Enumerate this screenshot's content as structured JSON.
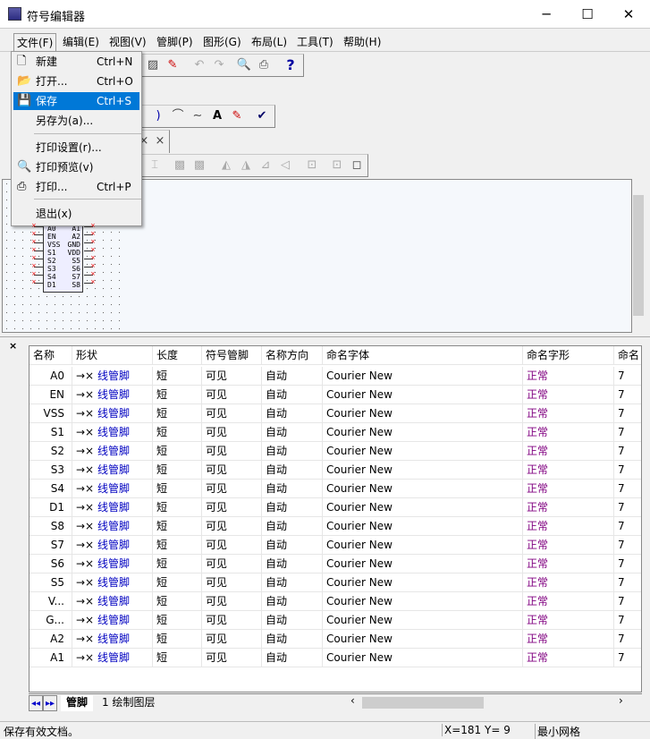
{
  "window": {
    "title": "符号编辑器",
    "minimize": "─",
    "maximize": "☐",
    "close": "✕"
  },
  "menubar": [
    "文件(F)",
    "编辑(E)",
    "视图(V)",
    "管脚(P)",
    "图形(G)",
    "布局(L)",
    "工具(T)",
    "帮助(H)"
  ],
  "file_menu": [
    {
      "label": "新建",
      "shortcut": "Ctrl+N",
      "icon": "new-file-icon"
    },
    {
      "label": "打开...",
      "shortcut": "Ctrl+O",
      "icon": "open-folder-icon"
    },
    {
      "label": "保存",
      "shortcut": "Ctrl+S",
      "icon": "save-icon",
      "selected": true
    },
    {
      "label": "另存为(a)...",
      "shortcut": ""
    },
    {
      "label": "打印设置(r)...",
      "shortcut": ""
    },
    {
      "label": "打印预览(v)",
      "shortcut": "",
      "icon": "print-preview-icon"
    },
    {
      "label": "打印...",
      "shortcut": "Ctrl+P",
      "icon": "printer-icon"
    },
    {
      "label": "退出(x)",
      "shortcut": ""
    }
  ],
  "toolbar": {
    "help": "?",
    "text_tool": "A",
    "close_a": "×",
    "close_b": "×"
  },
  "symbol": {
    "left_pins": [
      "A0",
      "EN",
      "VSS",
      "S1",
      "S2",
      "S3",
      "S4",
      "D1"
    ],
    "right_pins": [
      "A1",
      "A2",
      "GND",
      "VDD",
      "S5",
      "S6",
      "S7",
      "S8"
    ]
  },
  "panel_close": "×",
  "table": {
    "columns": [
      "名称",
      "形状",
      "长度",
      "符号管脚",
      "名称方向",
      "命名字体",
      "命名字形",
      "命名"
    ],
    "rows": [
      [
        "A0",
        "→× 线管脚",
        "短",
        "可见",
        "自动",
        "Courier New",
        "正常",
        "7"
      ],
      [
        "EN",
        "→× 线管脚",
        "短",
        "可见",
        "自动",
        "Courier New",
        "正常",
        "7"
      ],
      [
        "VSS",
        "→× 线管脚",
        "短",
        "可见",
        "自动",
        "Courier New",
        "正常",
        "7"
      ],
      [
        "S1",
        "→× 线管脚",
        "短",
        "可见",
        "自动",
        "Courier New",
        "正常",
        "7"
      ],
      [
        "S2",
        "→× 线管脚",
        "短",
        "可见",
        "自动",
        "Courier New",
        "正常",
        "7"
      ],
      [
        "S3",
        "→× 线管脚",
        "短",
        "可见",
        "自动",
        "Courier New",
        "正常",
        "7"
      ],
      [
        "S4",
        "→× 线管脚",
        "短",
        "可见",
        "自动",
        "Courier New",
        "正常",
        "7"
      ],
      [
        "D1",
        "→× 线管脚",
        "短",
        "可见",
        "自动",
        "Courier New",
        "正常",
        "7"
      ],
      [
        "S8",
        "→× 线管脚",
        "短",
        "可见",
        "自动",
        "Courier New",
        "正常",
        "7"
      ],
      [
        "S7",
        "→× 线管脚",
        "短",
        "可见",
        "自动",
        "Courier New",
        "正常",
        "7"
      ],
      [
        "S6",
        "→× 线管脚",
        "短",
        "可见",
        "自动",
        "Courier New",
        "正常",
        "7"
      ],
      [
        "S5",
        "→× 线管脚",
        "短",
        "可见",
        "自动",
        "Courier New",
        "正常",
        "7"
      ],
      [
        "V...",
        "→× 线管脚",
        "短",
        "可见",
        "自动",
        "Courier New",
        "正常",
        "7"
      ],
      [
        "G...",
        "→× 线管脚",
        "短",
        "可见",
        "自动",
        "Courier New",
        "正常",
        "7"
      ],
      [
        "A2",
        "→× 线管脚",
        "短",
        "可见",
        "自动",
        "Courier New",
        "正常",
        "7"
      ],
      [
        "A1",
        "→× 线管脚",
        "短",
        "可见",
        "自动",
        "Courier New",
        "正常",
        "7"
      ]
    ]
  },
  "sheet_tabs": [
    "管脚",
    "1 绘制图层"
  ],
  "sheet_nav": [
    "◂◂",
    "▸▸"
  ],
  "hscroll": {
    "left": "‹",
    "right": "›"
  },
  "status": {
    "message": "保存有效文档。",
    "coords": "X=181 Y=  9",
    "grid": "最小网格"
  },
  "colors": {
    "selection": "#0078d7",
    "pin_marker": "#e00000",
    "font_style": "#800080",
    "shape_arrow": "#0000c0"
  }
}
